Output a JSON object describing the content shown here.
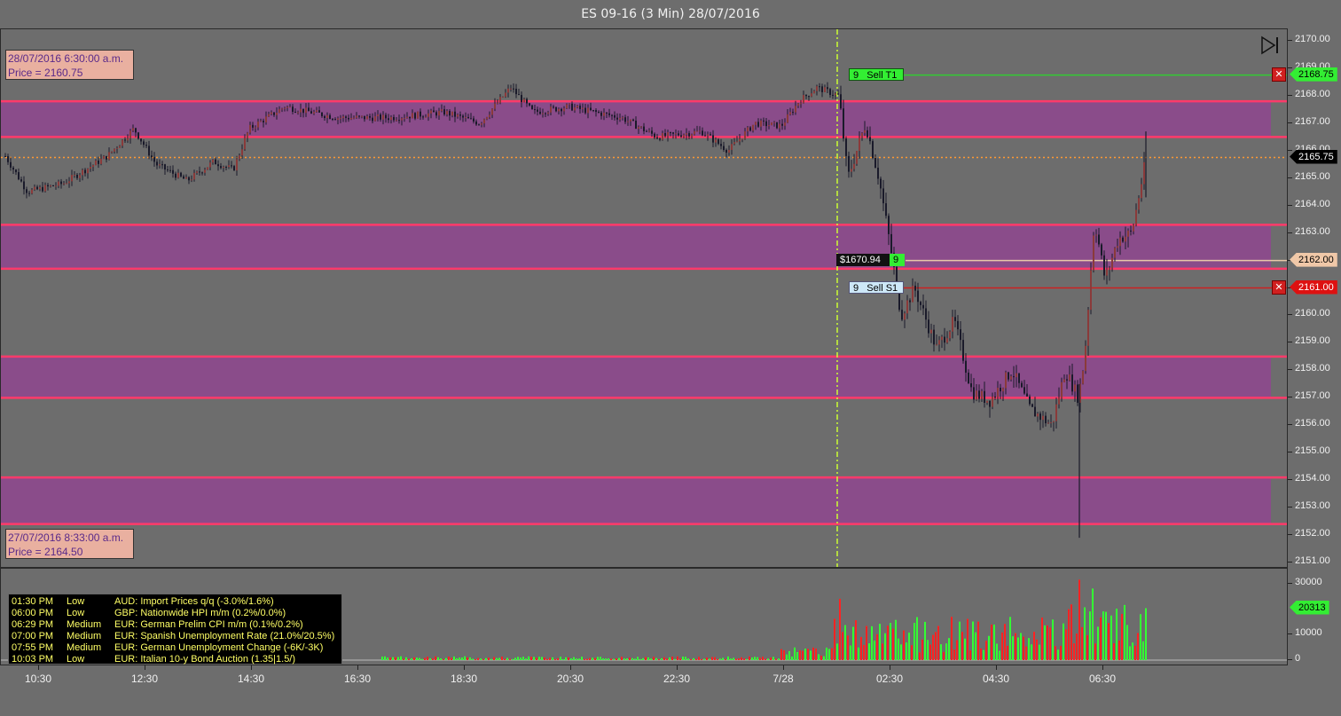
{
  "window": {
    "title": "ES 09-16 (3 Min)  28/07/2016"
  },
  "colors": {
    "background": "#6d6d6d",
    "zone_fill": "#8a4c8a",
    "zone_line": "#ff3a6a",
    "candle": "#1a1a2a",
    "target_line": "#33cc33",
    "stop_line": "#cc2222",
    "entry_line": "#e8c8a8",
    "current_price_line": "#ff9933",
    "volume_up": "#33ff33",
    "volume_down": "#ff2222",
    "session_line": "#ccff33"
  },
  "info_top": {
    "line1": "28/07/2016 6:30:00 a.m.",
    "line2": "Price = 2160.75"
  },
  "info_bottom": {
    "line1": "27/07/2016 8:33:00 a.m.",
    "line2": "Price = 2164.50"
  },
  "price_axis": {
    "ticks": [
      "2170.00",
      "2169.00",
      "2168.00",
      "2167.00",
      "2166.00",
      "2165.00",
      "2164.00",
      "2163.00",
      "2162.00",
      "2161.00",
      "2160.00",
      "2159.00",
      "2158.00",
      "2157.00",
      "2156.00",
      "2155.00",
      "2154.00",
      "2153.00",
      "2152.00",
      "2151.00"
    ],
    "min": 2150.8,
    "max": 2170.3
  },
  "markers": {
    "current_price": {
      "label": "2165.75",
      "value": 2165.75
    },
    "target": {
      "qty": "9",
      "name": "Sell T1",
      "label": "2168.75",
      "value": 2168.75
    },
    "entry": {
      "pnl": "$1670.94",
      "qty": "9",
      "label": "2162.00",
      "value": 2162.0
    },
    "stop": {
      "qty": "9",
      "name": "Sell S1",
      "label": "2161.00",
      "value": 2161.0
    }
  },
  "zones": [
    {
      "top": 2167.8,
      "bottom": 2166.5
    },
    {
      "top": 2163.3,
      "bottom": 2161.7
    },
    {
      "top": 2158.5,
      "bottom": 2157.0
    },
    {
      "top": 2154.1,
      "bottom": 2152.4
    }
  ],
  "volume_axis": {
    "ticks": [
      "30000",
      "10000",
      "0"
    ],
    "max": 33000,
    "current": "20313"
  },
  "x_axis": {
    "labels": [
      "10:30",
      "12:30",
      "14:30",
      "16:30",
      "18:30",
      "20:30",
      "22:30",
      "7/28",
      "02:30",
      "04:30",
      "06:30"
    ]
  },
  "news": [
    {
      "time": "01:30 PM",
      "impact": "Low",
      "event": "AUD: Import Prices q/q (-3.0%/1.6%)"
    },
    {
      "time": "06:00 PM",
      "impact": "Low",
      "event": "GBP: Nationwide HPI m/m (0.2%/0.0%)"
    },
    {
      "time": "06:29 PM",
      "impact": "Medium",
      "event": "EUR: German Prelim CPI m/m (0.1%/0.2%)"
    },
    {
      "time": "07:00 PM",
      "impact": "Medium",
      "event": "EUR: Spanish Unemployment Rate (21.0%/20.5%)"
    },
    {
      "time": "07:55 PM",
      "impact": "Medium",
      "event": "EUR: German Unemployment Change (-6K/-3K)"
    },
    {
      "time": "10:03 PM",
      "impact": "Low",
      "event": "EUR: Italian 10-y Bond Auction (1.35|1.5/)"
    }
  ],
  "icons": {
    "play_to_end": "play-to-end-icon",
    "close_order": "close-x-icon"
  }
}
